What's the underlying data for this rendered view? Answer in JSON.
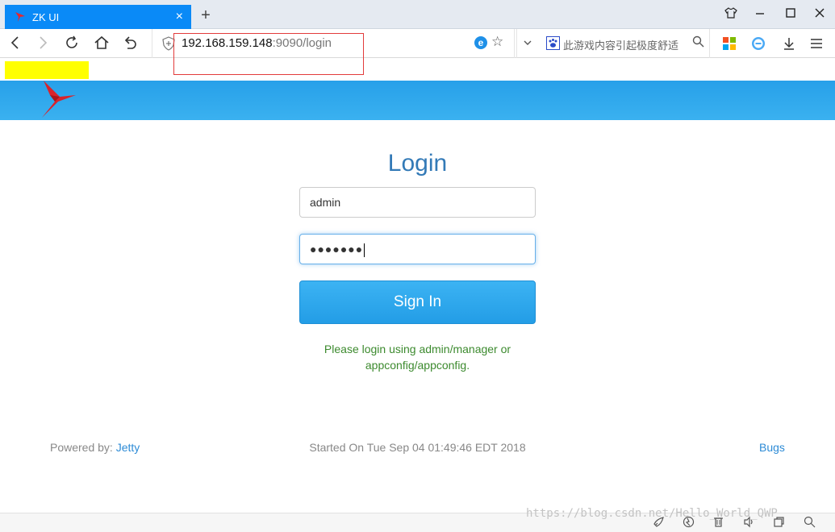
{
  "browser": {
    "tab_title": "ZK UI",
    "tab_close": "×",
    "new_tab": "+",
    "url_host": "192.168.159.148",
    "url_path": ":9090/login",
    "search_placeholder": "此游戏内容引起极度舒适",
    "watermark": "https://blog.csdn.net/Hello_World_QWP"
  },
  "login": {
    "title": "Login",
    "username_value": "admin",
    "password_mask": "●●●●●●●",
    "signin_label": "Sign In",
    "hint": "Please login using admin/manager or appconfig/appconfig."
  },
  "footer": {
    "powered_label": "Powered by: ",
    "powered_link": "Jetty",
    "started": "Started On Tue Sep 04 01:49:46 EDT 2018",
    "bugs": "Bugs"
  },
  "colors": {
    "tab_active": "#0a8af7",
    "header": "#2ea7ee",
    "title": "#337ab7",
    "button": "#2ba4eb",
    "hint": "#3c8a2e",
    "link": "#2d8bd6",
    "highlight": "#ffff00",
    "annotation_box": "#e23b3b"
  }
}
